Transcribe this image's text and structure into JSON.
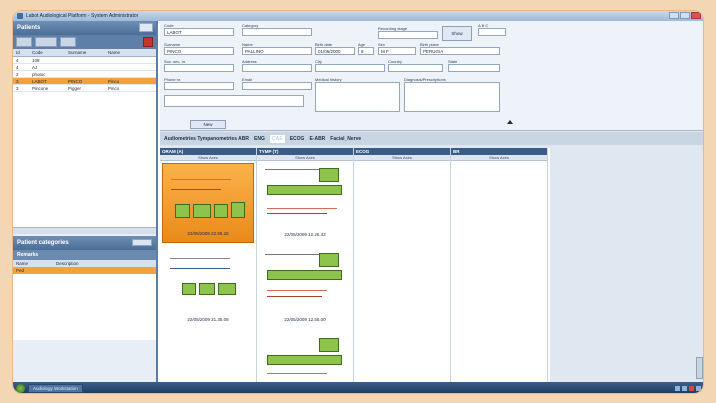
{
  "window": {
    "title": "Labot Audiological Platform - System Administrator"
  },
  "sidebar": {
    "patients_title": "Patients",
    "columns": [
      "Id",
      "Code",
      "Surname",
      "Name"
    ],
    "rows": [
      {
        "id": "4",
        "code": "108",
        "surname": "",
        "name": ""
      },
      {
        "id": "4",
        "code": "AJ",
        "surname": "",
        "name": ""
      },
      {
        "id": "2",
        "code": "photoc",
        "surname": "",
        "name": ""
      },
      {
        "id": "3",
        "code": "LABOT",
        "surname": "PINCO",
        "name": "Pinco",
        "selected": true
      },
      {
        "id": "3",
        "code": "Pincone",
        "surname": "Pigger",
        "name": "Pinco"
      }
    ],
    "categories_title": "Patient categories",
    "remarks_title": "Remarks",
    "cat_columns": [
      "Name",
      "Description"
    ],
    "cat_rows": [
      "Ped"
    ]
  },
  "form": {
    "code_label": "Code",
    "code": "LABOT",
    "category_label": "Category",
    "category": "",
    "surname_label": "Surname",
    "surname": "PINCO",
    "name_label": "Name",
    "name": "PALLINO",
    "birth_label": "Birth date",
    "birth": "01/06/2000",
    "age_label": "Age",
    "age": "8",
    "sex_label": "Sex",
    "sex_m": "M",
    "sex_f": "F",
    "birthplace_label": "Birth place",
    "birthplace": "PERUGIA",
    "ss_label": "Soc. sec. nr.",
    "ss": "",
    "address_label": "Address",
    "address": "",
    "city_label": "City",
    "city": "",
    "country_label": "Country",
    "country": "",
    "state_label": "State",
    "state": "",
    "phone_label": "Phone nr.",
    "phone": "",
    "email_label": "Email",
    "email": "",
    "hist_label": "Medical history",
    "hist": "",
    "diag_label": "Diagnosis/Prescriptions",
    "diag": "",
    "recording_label": "Recording stage",
    "recording": "",
    "show_btn": "Show",
    "new_btn": "New",
    "abc": [
      "A",
      "B",
      "C"
    ]
  },
  "exam": {
    "title": "Audiometries Tympanometries ABR",
    "sub1": "ENG",
    "sub2": "OAE",
    "sub3": "ECOG",
    "sub4": "E-ABR",
    "sub5": "Facial_Nerve"
  },
  "columns": [
    {
      "title": "ORAM (A)",
      "sub": "Show Axes",
      "cells": [
        {
          "stamp": "22/05/2009 22.55.26",
          "selected": true
        },
        {
          "stamp": "22/05/2009 21.35.08",
          "selected": false
        }
      ]
    },
    {
      "title": "TYMP (T)",
      "sub": "Show Axes",
      "cells": [
        {
          "stamp": "22/05/2009 12.26.43",
          "selected": false
        },
        {
          "stamp": "22/05/2009 12.55.00",
          "selected": false
        },
        {
          "stamp": "",
          "selected": false
        }
      ]
    },
    {
      "title": "ECOG",
      "sub": "Show Axes",
      "cells": []
    },
    {
      "title": "BR",
      "sub": "Show Axes",
      "cells": []
    }
  ],
  "taskbar": {
    "app_label": "Audiology Workstation"
  }
}
